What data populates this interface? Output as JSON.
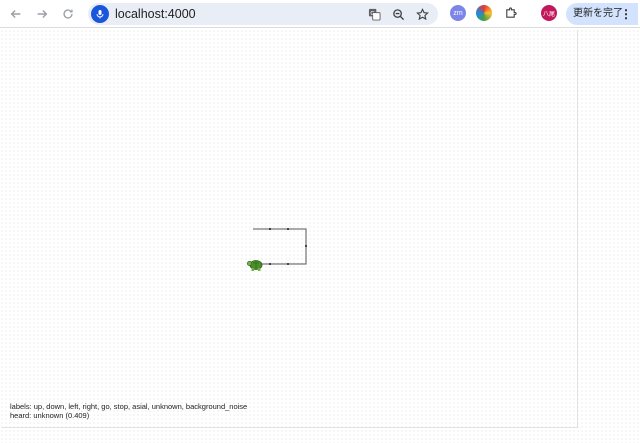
{
  "browser": {
    "url": "localhost:4000",
    "update_label": "更新を完了",
    "menu_glyph": "⋮",
    "extensions": [
      {
        "name": "zoom-ext",
        "text": "zm",
        "color": "#7b86e8"
      },
      {
        "name": "color-ext",
        "text": "",
        "color": "#f5a623"
      },
      {
        "name": "puzzle-ext",
        "text": "",
        "color": "#ffffff"
      },
      {
        "name": "profile-avatar",
        "text": "八尾",
        "color": "#c2185b"
      }
    ]
  },
  "page": {
    "labels_line": "labels: up, down, left, right, go, stop, asial, unknown, background_noise",
    "heard_line": "heard: unknown (0.409)"
  },
  "turtle": {
    "icon": "turtle-icon",
    "path_color": "#555555"
  }
}
